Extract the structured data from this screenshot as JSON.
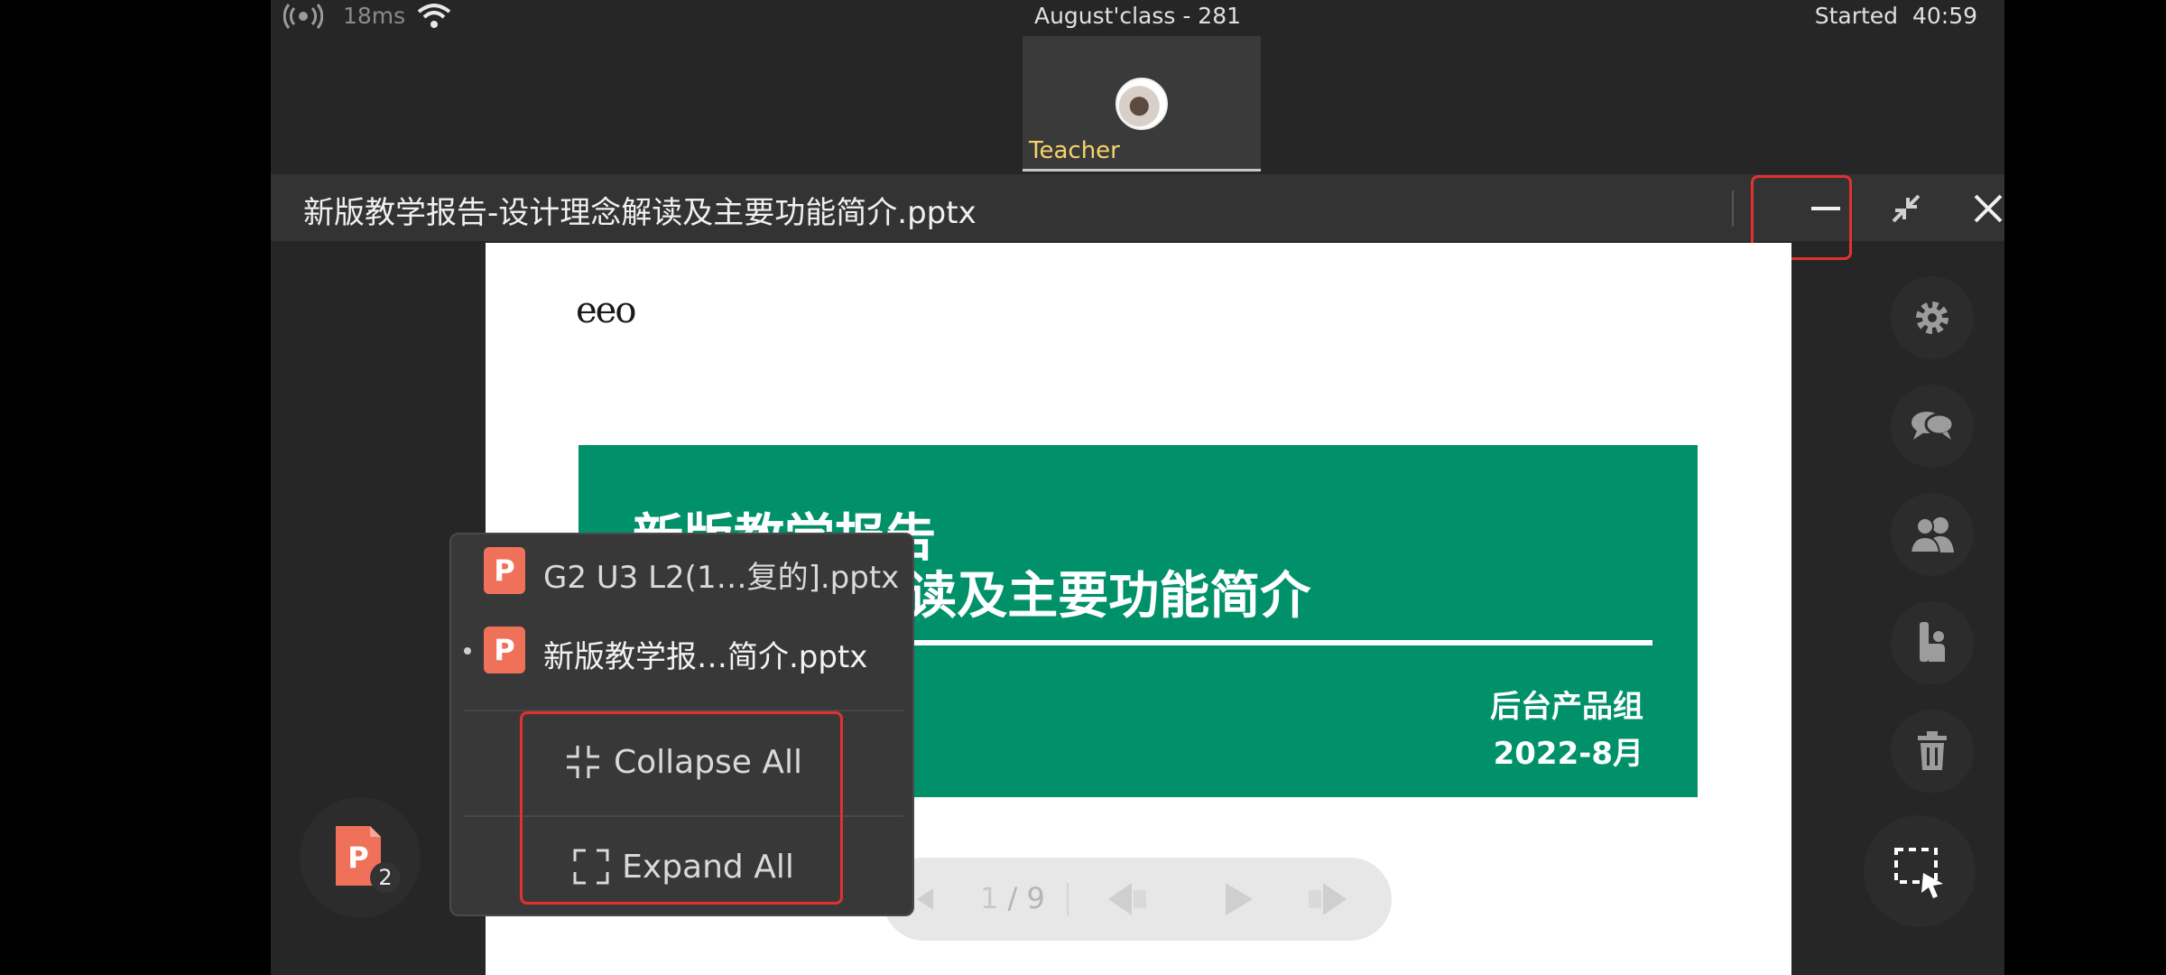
{
  "status_bar": {
    "latency": "18ms",
    "class_title": "August'class - 281",
    "started_label": "Started",
    "started_time": "40:59"
  },
  "video": {
    "name": "Teacher"
  },
  "file_bar": {
    "title": "新版教学报告-设计理念解读及主要功能简介.pptx"
  },
  "slide": {
    "logo": "eeo",
    "title_line1": "新版教学报告",
    "title_line2": "-设计理念解读及主要功能简介",
    "team": "后台产品组",
    "date": "2022-8月",
    "accent": "#00916a"
  },
  "page_control": {
    "current": "1",
    "total": "/ 9"
  },
  "file_list": {
    "count": "2",
    "items": [
      {
        "name": "G2 U3 L2(1…复的].pptx",
        "icon": "P"
      },
      {
        "name": "新版教学报…简介.pptx",
        "icon": "P"
      }
    ],
    "collapse_all": "Collapse All",
    "expand_all": "Expand All"
  },
  "colors": {
    "highlight": "#e3322d",
    "ppt_icon": "#f0715a"
  }
}
